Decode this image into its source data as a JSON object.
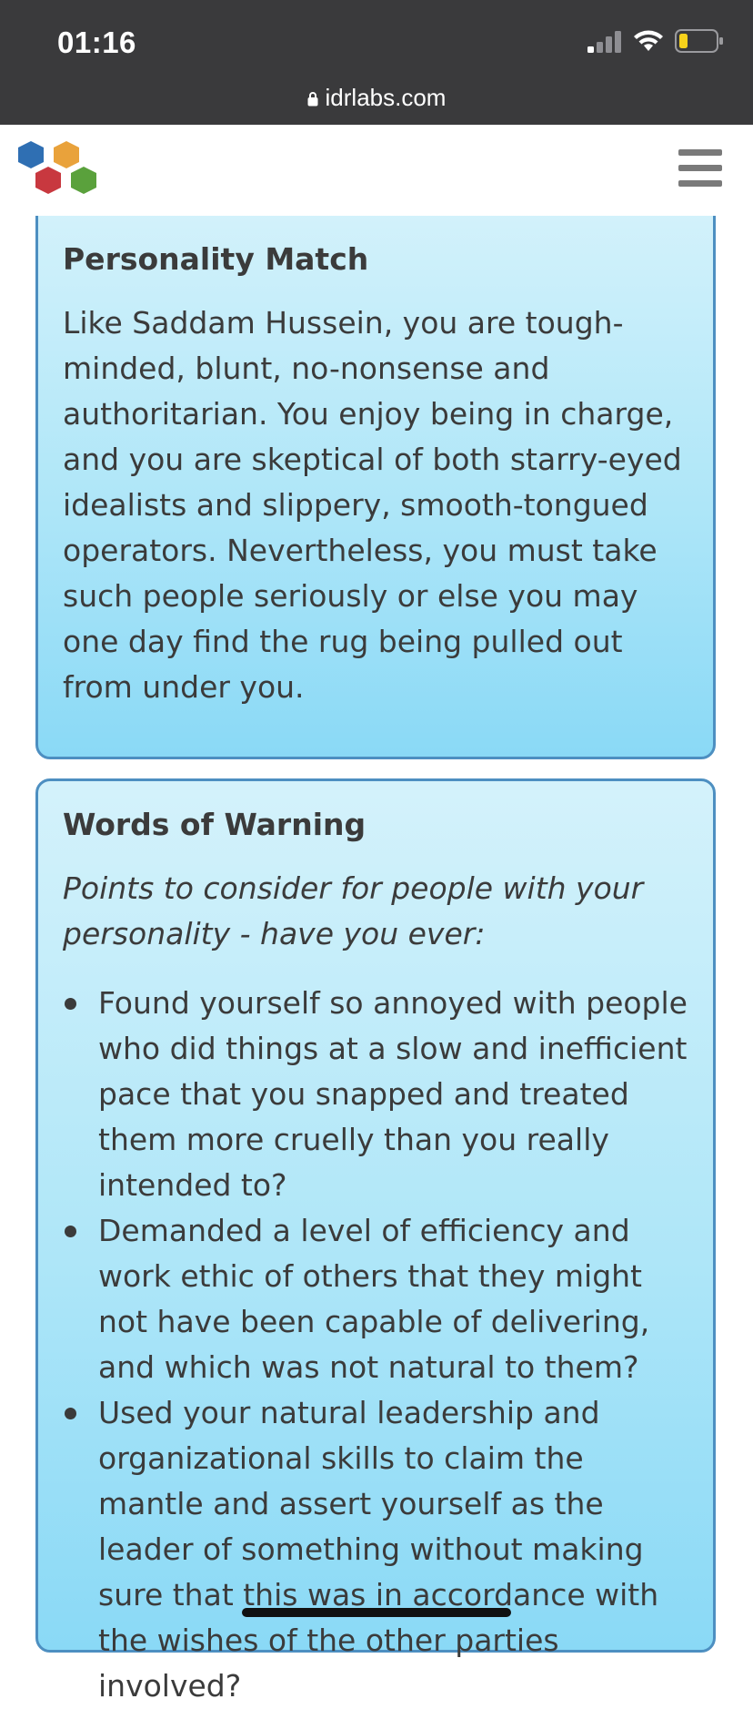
{
  "status_bar": {
    "time": "01:16",
    "icons": [
      "cellular-signal-icon",
      "wifi-icon",
      "battery-icon"
    ]
  },
  "url_bar": {
    "domain": "idrlabs.com",
    "icon": "lock-icon"
  },
  "header": {
    "logo": "idrlabs-hexagon-logo",
    "menu_icon": "hamburger-menu-icon"
  },
  "colors": {
    "card_border": "#4d8fc1",
    "card_gradient_top": "#d4f2fb",
    "card_gradient_bottom": "#8ad9f6",
    "text": "#3b3b3b",
    "status_bar_bg": "#3a3a3c",
    "logo_blue": "#2f6fb3",
    "logo_orange": "#e9a23b",
    "logo_red": "#c8383f",
    "logo_green": "#5aa13c"
  },
  "personality_match": {
    "title": "Personality Match",
    "body": "Like Saddam Hussein, you are tough-minded, blunt, no-nonsense and authoritarian. You enjoy being in charge, and you are skeptical of both starry-eyed idealists and slippery, smooth-tongued operators. Nevertheless, you must take such people seriously or else you may one day find the rug being pulled out from under you."
  },
  "words_of_warning": {
    "title": "Words of Warning",
    "intro": "Points to consider for people with your personality - have you ever:",
    "items": [
      "Found yourself so annoyed with people who did things at a slow and inefficient pace that you snapped and treated them more cruelly than you really intended to?",
      "Demanded a level of efficiency and work ethic of others that they might not have been capable of delivering, and which was not natural to them?",
      "Used your natural leadership and organizational skills to claim the mantle and assert yourself as the leader of something without making sure that this was in accordance with the wishes of the other parties involved?"
    ]
  }
}
